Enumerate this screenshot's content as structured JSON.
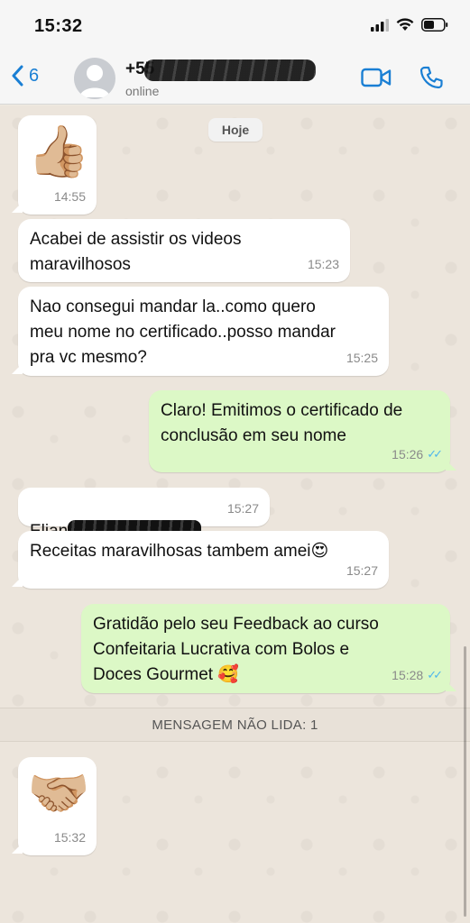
{
  "status_bar": {
    "time": "15:32"
  },
  "header": {
    "back_count": "6",
    "contact_name_visible": "+55",
    "contact_status": "online"
  },
  "chat": {
    "day_chip": "Hoje",
    "messages": [
      {
        "id": "m1",
        "direction": "in",
        "type": "emoji",
        "emoji": "👍🏼",
        "time": "14:55"
      },
      {
        "id": "m2",
        "direction": "in",
        "text": "Acabei de assistir os videos\nmaravilhosos",
        "time": "15:23"
      },
      {
        "id": "m3",
        "direction": "in",
        "text": "Nao consegui mandar la..como quero\nmeu nome no certificado..posso mandar\npra vc mesmo?",
        "time": "15:25"
      },
      {
        "id": "m4",
        "direction": "out",
        "text": "Claro! Emitimos o certificado de\nconclusão em seu nome",
        "time": "15:26",
        "read": true
      },
      {
        "id": "m5",
        "direction": "in",
        "text_prefix": "Elian",
        "redacted": true,
        "time": "15:27"
      },
      {
        "id": "m6",
        "direction": "in",
        "text": "Receitas maravilhosas tambem amei😍",
        "time": "15:27"
      },
      {
        "id": "m7",
        "direction": "out",
        "text": "Gratidão pelo seu Feedback ao curso\nConfeitaria Lucrativa com Bolos e\nDoces Gourmet 🥰",
        "time": "15:28",
        "read": true
      },
      {
        "id": "m8",
        "direction": "in",
        "type": "emoji",
        "emoji": "🤝🏼",
        "time": "15:32"
      }
    ],
    "unread_banner": "MENSAGEM NÃO LIDA: 1",
    "read_ticks": "✓✓"
  },
  "colors": {
    "accent_blue": "#1a7fd4",
    "bubble_in": "#ffffff",
    "bubble_out": "#dcf8c6",
    "read_tick": "#4fb6ec",
    "chat_background": "#ece5dc"
  },
  "icons": {
    "back": "chevron-left-icon",
    "avatar": "default-avatar-icon",
    "video": "video-camera-icon",
    "call": "phone-icon",
    "signal": "cellular-signal-icon",
    "wifi": "wifi-icon",
    "battery": "battery-icon"
  }
}
